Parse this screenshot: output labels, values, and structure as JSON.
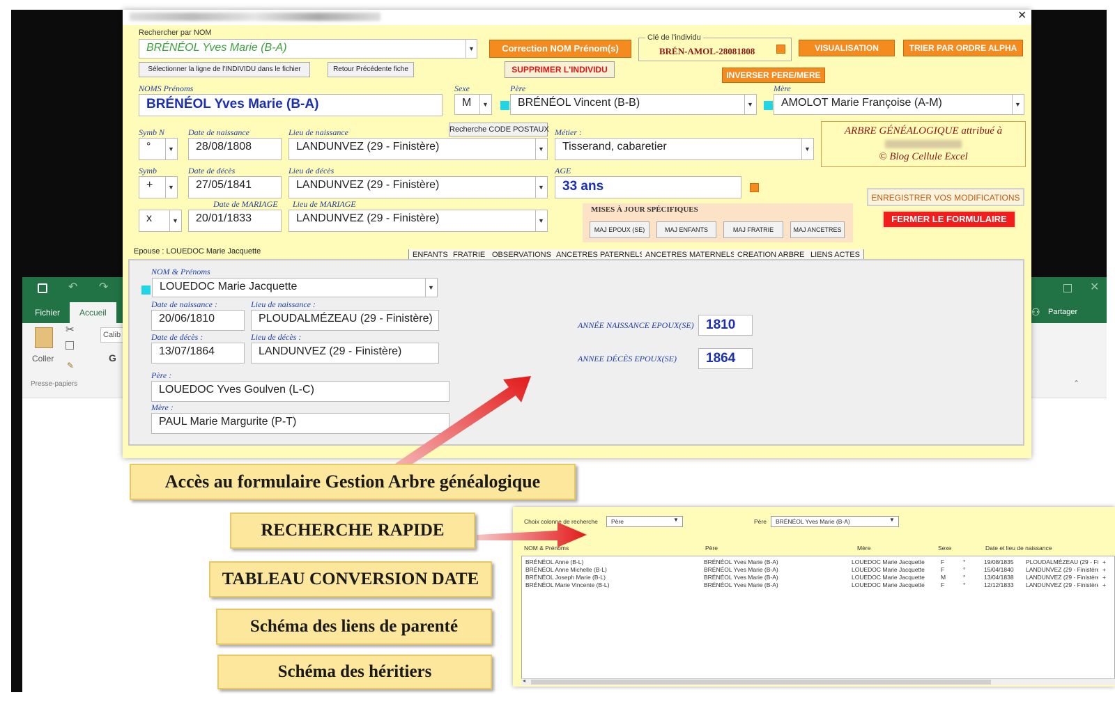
{
  "excel": {
    "tabs": [
      "Fichier",
      "Accueil"
    ],
    "paste_label": "Coller",
    "clipboard_label": "Presse-papiers",
    "font_stub": "Calib",
    "bold_stub": "G",
    "share_label": "Partager"
  },
  "form": {
    "search_label": "Rechercher par NOM",
    "search_value": "BRÉNÉOL Yves Marie (B-A)",
    "btn_correction": "Correction NOM Prénom(s)",
    "key_label": "Clé de l'individu",
    "key_value": "BRÉN-AMOL-28081808",
    "btn_visualisation": "VISUALISATION",
    "btn_trier": "TRIER PAR ORDRE ALPHA",
    "btn_select_line": "Sélectionner la ligne de l'INDIVIDU  dans le fichier",
    "btn_retour": "Retour Précédente fiche",
    "btn_supprimer": "SUPPRIMER L'INDIVIDU",
    "btn_inverser": "INVERSER PERE/MERE",
    "noms_label": "NOMS Prénoms",
    "noms_value": "BRÉNÉOL Yves Marie (B-A)",
    "sexe_label": "Sexe",
    "sexe_value": "M",
    "pere_label": "Père",
    "pere_value": "BRÉNÉOL Vincent (B-B)",
    "mere_label": "Mère",
    "mere_value": "AMOLOT Marie Françoise (A-M)",
    "symb_n_label": "Symb N",
    "symb_n_value": "°",
    "date_naissance_label": "Date de naissance",
    "date_naissance_value": "28/08/1808",
    "lieu_naissance_label": "Lieu de naissance",
    "lieu_naissance_value": "LANDUNVEZ (29 - Finistère)",
    "btn_code_postaux": "Recherche CODE POSTAUX",
    "metier_label": "Métier :",
    "metier_value": "Tisserand, cabaretier",
    "arbre_line1": "ARBRE GÉNÉALOGIQUE attribué à",
    "arbre_line3": "© Blog Cellule Excel",
    "symb_label": "Symb",
    "symb_value": "+",
    "date_deces_label": "Date de décès",
    "date_deces_value": "27/05/1841",
    "lieu_deces_label": "Lieu de décès",
    "lieu_deces_value": "LANDUNVEZ (29 - Finistère)",
    "age_label": "AGE",
    "age_value": "33 ans",
    "btn_enregistrer": "ENREGISTRER VOS MODIFICATIONS",
    "btn_fermer": "FERMER LE FORMULAIRE",
    "symb_m_value": "x",
    "date_mariage_label": "Date de MARIAGE",
    "date_mariage_value": "20/01/1833",
    "lieu_mariage_label": "Lieu de MARIAGE",
    "lieu_mariage_value": "LANDUNVEZ (29 - Finistère)",
    "maj_title": "MISES À JOUR SPÉCIFIQUES",
    "maj_buttons": [
      "MAJ EPOUX (SE)",
      "MAJ ENFANTS",
      "MAJ FRATRIE",
      "MAJ ANCETRES"
    ],
    "epouse_tab": "Epouse : LOUEDOC Marie Jacquette",
    "tabs": [
      "ENFANTS",
      "FRATRIE",
      "OBSERVATIONS",
      "ANCETRES PATERNELS",
      "ANCETRES MATERNELS",
      "CREATION ARBRE",
      "LIENS ACTES"
    ],
    "spouse": {
      "nom_label": "NOM & Prénoms",
      "nom_value": "LOUEDOC Marie Jacquette",
      "dn_label": "Date de naissance :",
      "dn_value": "20/06/1810",
      "ln_label": "Lieu de naissance :",
      "ln_value": "PLOUDALMÉZEAU (29 - Finistère)",
      "dd_label": "Date de décès :",
      "dd_value": "13/07/1864",
      "ld_label": "Lieu de décès :",
      "ld_value": "LANDUNVEZ (29 - Finistère)",
      "pere_label": "Père :",
      "pere_value": "LOUEDOC Yves Goulven (L-C)",
      "mere_label": "Mère :",
      "mere_value": "PAUL Marie Margurite (P-T)",
      "annee_naiss_label": "ANNÉE NAISSANCE EPOUX(SE)",
      "annee_naiss_value": "1810",
      "annee_deces_label": "ANNEE DÉCÈS EPOUX(SE)",
      "annee_deces_value": "1864"
    }
  },
  "callouts": [
    "Accès au formulaire Gestion Arbre généalogique",
    "RECHERCHE RAPIDE",
    "TABLEAU CONVERSION DATE",
    "Schéma des liens de parenté",
    "Schéma des héritiers"
  ],
  "quick_search": {
    "choix_label": "Choix colonne de recherche",
    "choix_value": "Père",
    "pere_label": "Père",
    "pere_value": "BRÉNÉOL Yves Marie (B-A)",
    "columns": [
      "NOM & Prénoms",
      "Père",
      "Mère",
      "Sexe",
      "Date et lieu de naissance"
    ],
    "rows": [
      [
        "BRÉNÉOL Anne (B-L)",
        "BRÉNÉOL Yves Marie (B-A)",
        "LOUEDOC Marie Jacquette",
        "F",
        "°",
        "19/08/1835",
        "PLOUDALMÉZEAU (29 - Fir",
        "+"
      ],
      [
        "BRÉNÉOL Anne Michelle (B-L)",
        "BRÉNÉOL Yves Marie (B-A)",
        "LOUEDOC Marie Jacquette",
        "F",
        "°",
        "15/04/1840",
        "LANDUNVEZ (29 - Finistère",
        "+"
      ],
      [
        "BRÉNÉOL Joseph Marie (B-L)",
        "BRÉNÉOL Yves Marie (B-A)",
        "LOUEDOC Marie Jacquette",
        "M",
        "°",
        "13/04/1838",
        "LANDUNVEZ (29 - Finistère",
        "+"
      ],
      [
        "BRÉNÉOL Marie Vincente (B-L)",
        "BRÉNÉOL Yves Marie (B-A)",
        "LOUEDOC Marie Jacquette",
        "F",
        "°",
        "12/12/1833",
        "LANDUNVEZ (29 - Finistère",
        "+"
      ]
    ]
  },
  "colors": {
    "form_bg": "#fffbb8",
    "orange_button": "#f58a1f",
    "red_button": "#f31d1d",
    "excel_green": "#217346",
    "field_blue": "#1a2fb5",
    "arrow_red": "#e31a1a"
  }
}
